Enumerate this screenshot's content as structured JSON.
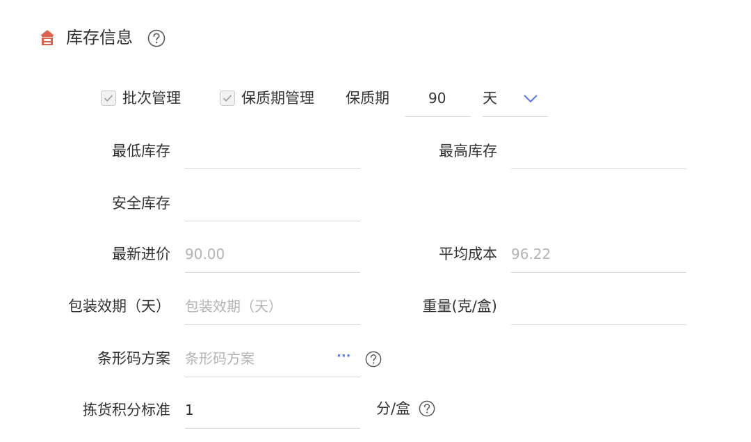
{
  "header": {
    "title": "库存信息"
  },
  "checks": {
    "batch_label": "批次管理",
    "shelf_mgmt_label": "保质期管理",
    "shelf_period_label": "保质期",
    "shelf_period_value": "90",
    "shelf_period_unit": "天"
  },
  "fields": {
    "min_stock_label": "最低库存",
    "min_stock_value": "",
    "max_stock_label": "最高库存",
    "max_stock_value": "",
    "safety_stock_label": "安全库存",
    "safety_stock_value": "",
    "latest_price_label": "最新进价",
    "latest_price_value": "90.00",
    "avg_cost_label": "平均成本",
    "avg_cost_value": "96.22",
    "pack_expiry_label": "包装效期（天）",
    "pack_expiry_placeholder": "包装效期（天）",
    "weight_label": "重量(克/盒)",
    "weight_value": "",
    "barcode_label": "条形码方案",
    "barcode_placeholder": "条形码方案",
    "barcode_more": "···",
    "pick_score_label": "拣货积分标准",
    "pick_score_value": "1",
    "pick_score_unit": "分/盒"
  },
  "colors": {
    "accent": "#5b7cf0",
    "home_icon": "#e0604f",
    "underline": "#d9d9d9",
    "muted_text": "#b3b3b3"
  },
  "icons": [
    "home-icon",
    "help-icon",
    "check-icon",
    "chevron-down-icon",
    "more-icon"
  ]
}
